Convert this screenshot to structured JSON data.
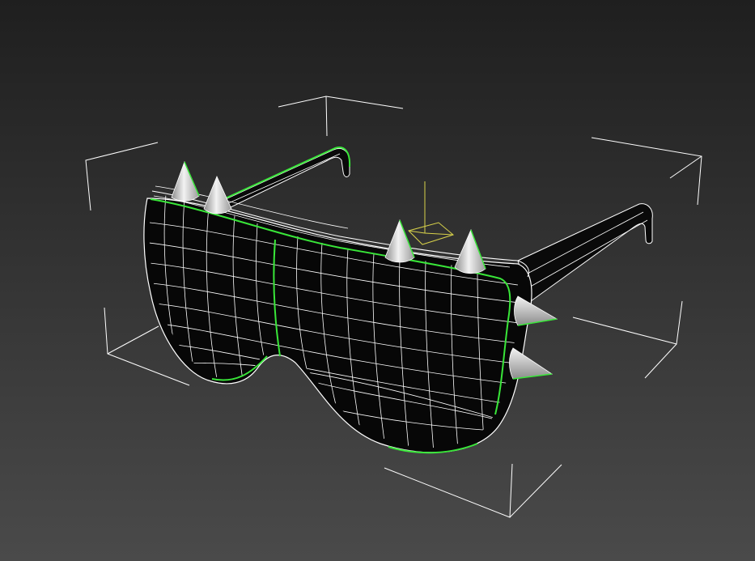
{
  "viewport": {
    "background_top": "#1f1f1f",
    "background_bottom": "#4a4a4a",
    "wire_color": "#ffffff",
    "selection_color": "#39e639",
    "gizmo_color": "#d8d24a",
    "lens_fill": "#070707",
    "spike_light": "#f2f2f2",
    "spike_dark": "#8c8c8c"
  },
  "scene": {
    "object": "spiked-sunglasses-model",
    "selected": true,
    "spike_count": 6
  }
}
